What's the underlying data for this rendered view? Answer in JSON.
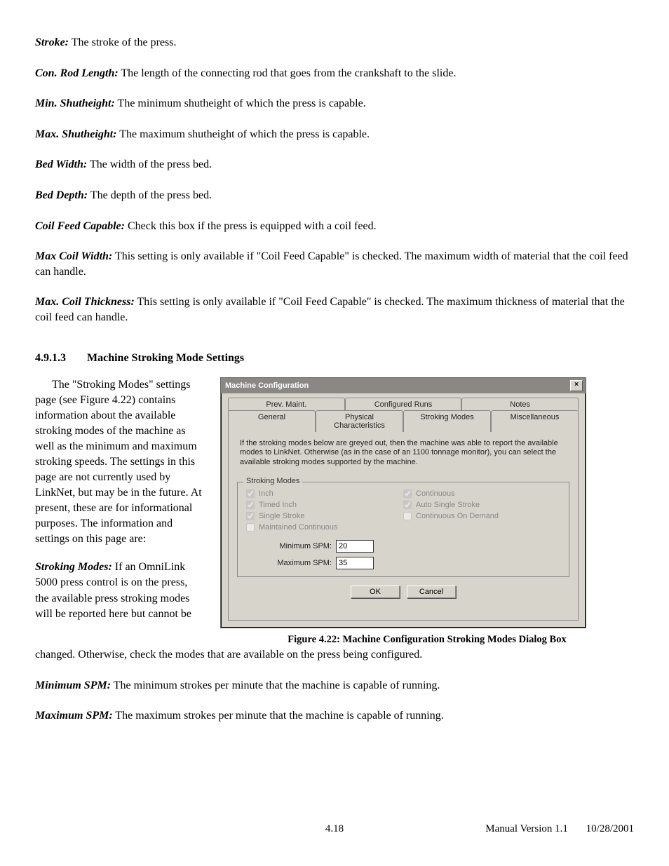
{
  "defs": [
    {
      "term": "Stroke:",
      "body": "  The stroke of the press."
    },
    {
      "term": "Con. Rod Length:",
      "body": "  The length of the connecting rod that goes from the crankshaft to the slide."
    },
    {
      "term": "Min. Shutheight:",
      "body": "  The minimum shutheight of which the press is capable."
    },
    {
      "term": "Max. Shutheight:",
      "body": "  The maximum shutheight of which the press is capable."
    },
    {
      "term": "Bed Width:",
      "body": "  The width of the press bed."
    },
    {
      "term": "Bed Depth:",
      "body": "  The depth of the press bed."
    },
    {
      "term": "Coil Feed Capable:",
      "body": "  Check this box if the press is equipped with a coil feed."
    },
    {
      "term": "Max Coil Width:",
      "body": "  This setting is only available if \"Coil Feed Capable\" is checked.  The maximum width of material that the coil feed can handle."
    },
    {
      "term": "Max. Coil Thickness:",
      "body": "  This setting is only available if \"Coil Feed Capable\" is checked.  The maximum thickness of material that the coil feed can handle."
    }
  ],
  "section": {
    "num": "4.9.1.3",
    "title": "Machine Stroking Mode Settings"
  },
  "intro_para": "The \"Stroking Modes\" settings page (see Figure 4.22) contains information about the available stroking modes of the machine as well as the minimum and maximum stroking speeds.  The settings in this page are not currently used by LinkNet, but may be in the future.  At present, these are for informational purposes. The information and settings on this page are:",
  "stroking_modes_para": {
    "term": "Stroking Modes:",
    "body": "  If an OmniLink 5000 press control is on the press, the available press stroking modes will be reported here but cannot be"
  },
  "after_fig_para": "changed.  Otherwise, check the modes that are available on the press being configured.",
  "defs2": [
    {
      "term": "Minimum SPM:",
      "body": "  The minimum strokes per minute that the machine is capable of running."
    },
    {
      "term": "Maximum SPM:",
      "body": "  The maximum strokes per minute that the machine is capable of running."
    }
  ],
  "dialog": {
    "title": "Machine Configuration",
    "close": "×",
    "tabs_row1": [
      "Prev. Maint.",
      "Configured Runs",
      "Notes"
    ],
    "tabs_row2": [
      "General",
      "Physical Characteristics",
      "Stroking Modes",
      "Miscellaneous"
    ],
    "active_tab": "Stroking Modes",
    "info": "If the stroking modes below are greyed out, then the machine was able to report the available modes to LinkNet.  Otherwise (as in the case of an 1100 tonnage monitor), you can select the available stroking modes supported by the machine.",
    "legend": "Stroking Modes",
    "checks": [
      {
        "label": "Inch",
        "checked": true
      },
      {
        "label": "Continuous",
        "checked": true
      },
      {
        "label": "Timed Inch",
        "checked": true
      },
      {
        "label": "Auto Single Stroke",
        "checked": true
      },
      {
        "label": "Single Stroke",
        "checked": true
      },
      {
        "label": "Continuous On Demand",
        "checked": false
      },
      {
        "label": "Maintained Continuous",
        "checked": false
      },
      {
        "label": "",
        "checked": false
      }
    ],
    "min_spm_label": "Minimum SPM:",
    "min_spm_value": "20",
    "max_spm_label": "Maximum SPM:",
    "max_spm_value": "35",
    "ok": "OK",
    "cancel": "Cancel"
  },
  "figure_caption": "Figure 4.22: Machine Configuration Stroking Modes Dialog Box",
  "footer": {
    "page": "4.18",
    "version": "Manual Version 1.1",
    "date": "10/28/2001"
  }
}
